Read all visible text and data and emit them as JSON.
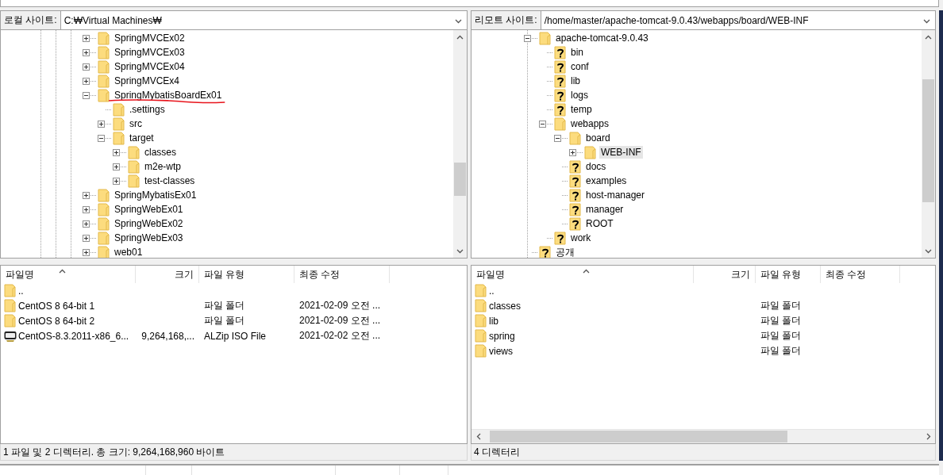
{
  "local": {
    "site_label": "로컬 사이트:",
    "path": "C:₩Virtual Machines₩",
    "tree": [
      {
        "name": "SpringMVCEx02",
        "kind": "folder",
        "expanded": false,
        "selected": false
      },
      {
        "name": "SpringMVCEx03",
        "kind": "folder",
        "expanded": false,
        "selected": false
      },
      {
        "name": "SpringMVCEx04",
        "kind": "folder",
        "expanded": false,
        "selected": false
      },
      {
        "name": "SpringMVCEx4",
        "kind": "folder",
        "expanded": false,
        "selected": false
      },
      {
        "name": "SpringMybatisBoardEx01",
        "kind": "folder",
        "expanded": true,
        "selected": false,
        "marked": true,
        "children": [
          {
            "name": ".settings",
            "kind": "folder",
            "selected": false
          },
          {
            "name": "src",
            "kind": "folder",
            "expanded": false,
            "selected": false
          },
          {
            "name": "target",
            "kind": "folder",
            "expanded": true,
            "selected": false,
            "children": [
              {
                "name": "classes",
                "kind": "folder",
                "expanded": false,
                "selected": false
              },
              {
                "name": "m2e-wtp",
                "kind": "folder",
                "expanded": false,
                "selected": false
              },
              {
                "name": "test-classes",
                "kind": "folder",
                "expanded": false,
                "selected": false
              }
            ]
          }
        ]
      },
      {
        "name": "SpringMybatisEx01",
        "kind": "folder",
        "expanded": false,
        "selected": false
      },
      {
        "name": "SpringWebEx01",
        "kind": "folder",
        "expanded": false,
        "selected": false
      },
      {
        "name": "SpringWebEx02",
        "kind": "folder",
        "expanded": false,
        "selected": false
      },
      {
        "name": "SpringWebEx03",
        "kind": "folder",
        "expanded": false,
        "selected": false
      },
      {
        "name": "web01",
        "kind": "folder",
        "expanded": false,
        "selected": false
      }
    ],
    "list": {
      "columns": [
        "파일명",
        "크기",
        "파일 유형",
        "최종 수정"
      ],
      "rows": [
        {
          "kind": "folder",
          "cells": [
            "..",
            "",
            "",
            ""
          ]
        },
        {
          "kind": "folder",
          "cells": [
            "CentOS 8 64-bit 1",
            "",
            "파일 폴더",
            "2021-02-09 오전 ..."
          ]
        },
        {
          "kind": "folder",
          "cells": [
            "CentOS 8 64-bit 2",
            "",
            "파일 폴더",
            "2021-02-09 오전 ..."
          ]
        },
        {
          "kind": "disc",
          "cells": [
            "CentOS-8.3.2011-x86_6...",
            "9,264,168,...",
            "ALZip ISO File",
            "2021-02-02 오전 ..."
          ]
        }
      ]
    },
    "status": "1 파일 및 2 디렉터리. 총 크기: 9,264,168,960 바이트"
  },
  "remote": {
    "site_label": "리모트 사이트:",
    "path": "/home/master/apache-tomcat-9.0.43/webapps/board/WEB-INF",
    "tree": [
      {
        "name": "apache-tomcat-9.0.43",
        "kind": "folder",
        "expanded": true,
        "selected": false,
        "children": [
          {
            "name": "bin",
            "kind": "unknown",
            "selected": false
          },
          {
            "name": "conf",
            "kind": "unknown",
            "selected": false
          },
          {
            "name": "lib",
            "kind": "unknown",
            "selected": false
          },
          {
            "name": "logs",
            "kind": "unknown",
            "selected": false
          },
          {
            "name": "temp",
            "kind": "unknown",
            "selected": false
          },
          {
            "name": "webapps",
            "kind": "folder",
            "expanded": true,
            "selected": false,
            "children": [
              {
                "name": "board",
                "kind": "folder",
                "expanded": true,
                "selected": false,
                "children": [
                  {
                    "name": "WEB-INF",
                    "kind": "folder",
                    "expanded": false,
                    "selected": true
                  }
                ]
              },
              {
                "name": "docs",
                "kind": "unknown",
                "selected": false
              },
              {
                "name": "examples",
                "kind": "unknown",
                "selected": false
              },
              {
                "name": "host-manager",
                "kind": "unknown",
                "selected": false
              },
              {
                "name": "manager",
                "kind": "unknown",
                "selected": false
              },
              {
                "name": "ROOT",
                "kind": "unknown",
                "selected": false
              }
            ]
          },
          {
            "name": "work",
            "kind": "unknown",
            "selected": false
          }
        ]
      },
      {
        "name": "공개",
        "kind": "unknown",
        "selected": false
      }
    ],
    "list": {
      "columns": [
        "파일명",
        "크기",
        "파일 유형",
        "최종 수정"
      ],
      "rows": [
        {
          "kind": "folder",
          "cells": [
            "..",
            "",
            "",
            ""
          ]
        },
        {
          "kind": "folder",
          "cells": [
            "classes",
            "",
            "파일 폴더",
            ""
          ]
        },
        {
          "kind": "folder",
          "cells": [
            "lib",
            "",
            "파일 폴더",
            ""
          ]
        },
        {
          "kind": "folder",
          "cells": [
            "spring",
            "",
            "파일 폴더",
            ""
          ]
        },
        {
          "kind": "folder",
          "cells": [
            "views",
            "",
            "파일 폴더",
            ""
          ]
        }
      ]
    },
    "status": "4 디렉터리"
  }
}
